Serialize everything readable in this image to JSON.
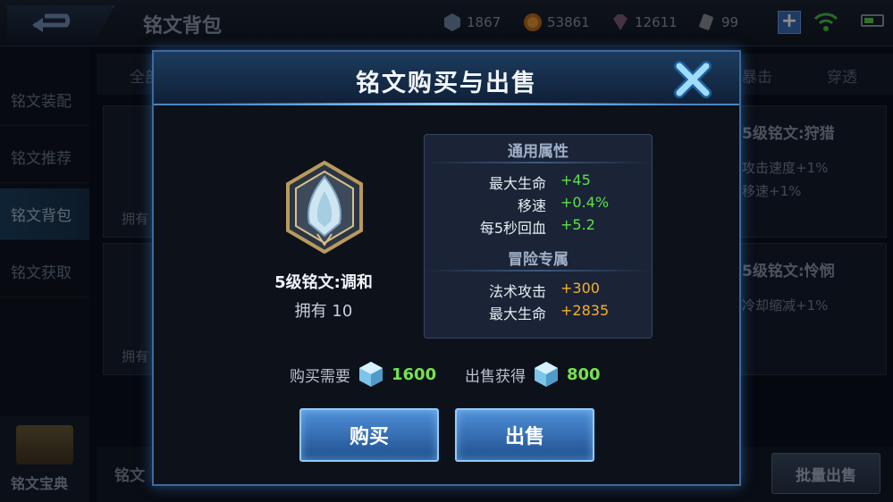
{
  "topbar": {
    "title": "铭文背包",
    "resources": {
      "gem": "1867",
      "coin": "53861",
      "diamond": "12611",
      "scroll": "99"
    },
    "plus_label": "+"
  },
  "sidebar": {
    "items": [
      {
        "label": "铭文装配"
      },
      {
        "label": "铭文推荐"
      },
      {
        "label": "铭文背包"
      },
      {
        "label": "铭文获取"
      }
    ],
    "codex_label": "铭文宝典"
  },
  "filter_tabs": [
    "全部",
    "暴击",
    "穿透"
  ],
  "list": {
    "own_label_1": "拥有",
    "own_label_2": "拥有"
  },
  "right_cards": [
    {
      "title": "5级铭文:狩猎",
      "lines": [
        "攻击速度+1%",
        "移速+1%"
      ]
    },
    {
      "title": "5级铭文:怜悯",
      "lines": [
        "冷却缩减+1%"
      ]
    }
  ],
  "bottom": {
    "label": "铭文",
    "batch_sell": "批量出售"
  },
  "modal": {
    "title": "铭文购买与出售",
    "rune": {
      "name": "5级铭文:调和",
      "owned": "拥有 10"
    },
    "general": {
      "title": "通用属性",
      "attrs": [
        {
          "label": "最大生命",
          "value": "+45"
        },
        {
          "label": "移速",
          "value": "+0.4%"
        },
        {
          "label": "每5秒回血",
          "value": "+5.2"
        }
      ]
    },
    "adventure": {
      "title": "冒险专属",
      "attrs": [
        {
          "label": "法术攻击",
          "value": "+300"
        },
        {
          "label": "最大生命",
          "value": "+2835"
        }
      ]
    },
    "buy": {
      "label": "购买需要",
      "price": "1600"
    },
    "sell": {
      "label": "出售获得",
      "price": "800"
    },
    "buy_button": "购买",
    "sell_button": "出售"
  },
  "colors": {
    "accent_blue": "#4f8fd8",
    "value_green": "#5ee04a",
    "value_orange": "#f5b033"
  }
}
